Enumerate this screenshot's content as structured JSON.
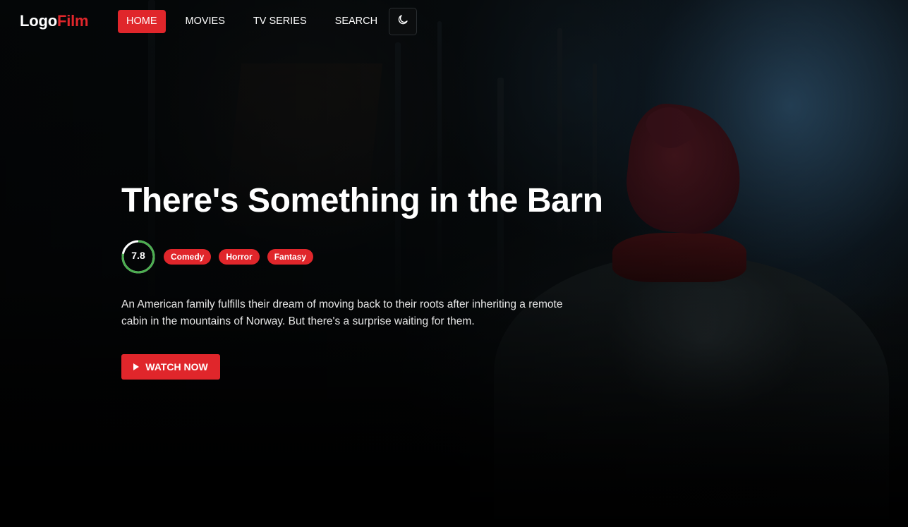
{
  "header": {
    "logo_primary": "Logo",
    "logo_accent": "Film",
    "nav": [
      {
        "label": "HOME",
        "active": true
      },
      {
        "label": "MOVIES",
        "active": false
      },
      {
        "label": "TV SERIES",
        "active": false
      },
      {
        "label": "SEARCH",
        "active": false
      }
    ],
    "theme_toggle_icon": "moon-icon"
  },
  "hero": {
    "title": "There's Something in the Barn",
    "rating": "7.8",
    "rating_fraction": 0.78,
    "genres": [
      "Comedy",
      "Horror",
      "Fantasy"
    ],
    "overview": "An American family fulfills their dream of moving back to their roots after inheriting a remote cabin in the mountains of Norway. But there's a surprise waiting for them.",
    "watch_label": "WATCH NOW",
    "watch_icon": "play-icon"
  },
  "colors": {
    "accent": "#e0262b",
    "rating_ring": "#4caf50",
    "background": "#000000"
  }
}
